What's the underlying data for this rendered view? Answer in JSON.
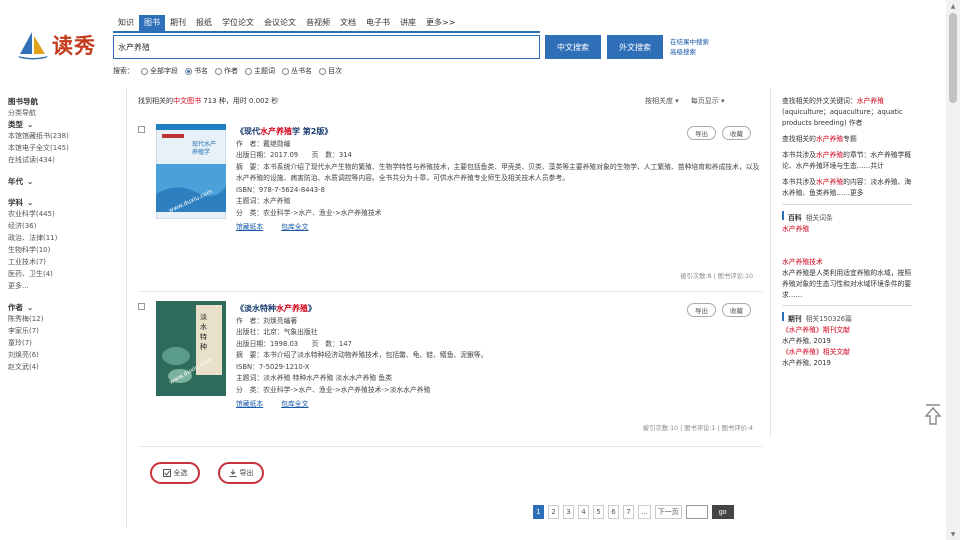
{
  "logo": {
    "text": "读秀"
  },
  "nav": {
    "items": [
      "知识",
      "图书",
      "期刊",
      "报纸",
      "学位论文",
      "会议论文",
      "音视频",
      "文档",
      "电子书",
      "讲座",
      "更多>>"
    ],
    "active_index": 1
  },
  "search": {
    "value": "水产养殖",
    "btn_cn": "中文搜索",
    "btn_foreign": "外文搜索",
    "side_links": [
      "在结果中搜索",
      "高级搜索"
    ],
    "scope_label": "搜索：",
    "scope_options": [
      "全部字段",
      "书名",
      "作者",
      "主题词",
      "丛书名",
      "目次"
    ],
    "scope_checked": 1
  },
  "sidebar": {
    "heading": "图书导航",
    "nav_link": "分类导航",
    "groups": [
      {
        "title": "类型",
        "items": [
          "本馆馆藏纸书(238)",
          "本馆电子全文(145)",
          "在线试读(434)"
        ]
      },
      {
        "title": "年代",
        "items": []
      },
      {
        "title": "学科",
        "items": [
          "农业科学(445)",
          "经济(36)",
          "政治、法律(11)",
          "生物科学(10)",
          "工业技术(7)",
          "医药、卫生(4)",
          "更多..."
        ]
      },
      {
        "title": "作者",
        "items": [
          "陈秀梅(12)",
          "李家乐(7)",
          "童玲(7)",
          "刘焕亮(6)",
          "赵文武(4)"
        ]
      }
    ]
  },
  "summary": {
    "prefix": "找到相关的",
    "highlight": "中文图书",
    "suffix": "713 种，用时 0.002 秒"
  },
  "sort_tools": [
    "按相关度 ▾",
    "每页显示 ▾"
  ],
  "results": [
    {
      "title_prefix": "《现代",
      "title_hl": "水产养殖",
      "title_suffix": "学 第2版》",
      "author": "作　者：戴继勋编",
      "pub": "出版日期：2017.09　　页　数：314",
      "abstract": "摘　要：本书系统介绍了现代水产生物的繁殖、生物学特性与养殖技术，主要包括鱼类、甲壳类、贝类、藻类等主要养殖对象的生物学、人工繁殖、苗种培育和养成技术，以及水产养殖的设施、病害防治、水质调控等内容。全书共分为十章，可供水产养殖专业师生及相关技术人员参考。",
      "isbn": "ISBN：978-7-5624-8443-8",
      "subject": "主题词：水产养殖",
      "class": "分　类：农业科学->水产、渔业->水产养殖技术",
      "links": [
        "馆藏纸本",
        "包库全文"
      ],
      "stats": "被引次数:8 | 图书评论:10",
      "actions": [
        "导出",
        "收藏"
      ]
    },
    {
      "title_prefix": "《淡水特种",
      "title_hl": "水产养殖",
      "title_suffix": "》",
      "author": "作　者：刘焕亮编著",
      "pub": "出版社：北京：气象出版社",
      "pub2": "出版日期：1998.03　　页　数：147",
      "abstract": "摘　要：本书介绍了淡水特种经济动物养殖技术，包括鳖、龟、蛙、鳝鱼、泥鳅等。",
      "isbn": "ISBN：7-5029-1210-X",
      "subject": "主题词：淡水养殖 特种水产养殖 淡水水产养殖 鱼类",
      "class": "分　类：农业科学->水产、渔业->水产养殖技术->淡水水产养殖",
      "links": [
        "馆藏纸本",
        "包库全文"
      ],
      "stats": "被引次数:10 | 图书评论:1 | 图书评价:4",
      "actions": [
        "导出",
        "收藏"
      ]
    }
  ],
  "bottom_actions": {
    "select_all": "全选",
    "export": "导出"
  },
  "pagination": {
    "pages": [
      "1",
      "2",
      "3",
      "4",
      "5",
      "6",
      "7",
      "...",
      "下一页"
    ],
    "current": "1",
    "go": "go"
  },
  "right_panel": {
    "entries": [
      {
        "text": "查找相关的外文关键词：",
        "hl": "水产养殖",
        "rest": "(aquiculture；aquaculture；aquatic products breeding) 作者"
      },
      {
        "text": "查找相关的",
        "hl": "水产养殖",
        "rest": "专题"
      },
      {
        "text": "本书共涉及",
        "hl": "水产养殖",
        "rest": "的章节：水产养殖学概论、水产养殖环境与生态……共计"
      },
      {
        "text": "本书共涉及",
        "hl": "水产养殖",
        "rest": "的内容：淡水养殖、海水养殖、鱼类养殖……更多"
      }
    ],
    "wiki": {
      "title": "百科",
      "sub": "相关词条",
      "item": "水产养殖"
    },
    "wiki_detail": {
      "item": "水产养殖技术",
      "desc": "水产养殖是人类利用适宜养殖的水域，按照养殖对象的生态习性和对水域环境条件的要求……"
    },
    "journals": {
      "title": "期刊",
      "sub": "相关150326篇",
      "items": [
        "《水产养殖》期刊文献",
        "水产养殖, 2019",
        "《水产养殖》相关文献",
        "水产养殖, 2019"
      ]
    }
  }
}
